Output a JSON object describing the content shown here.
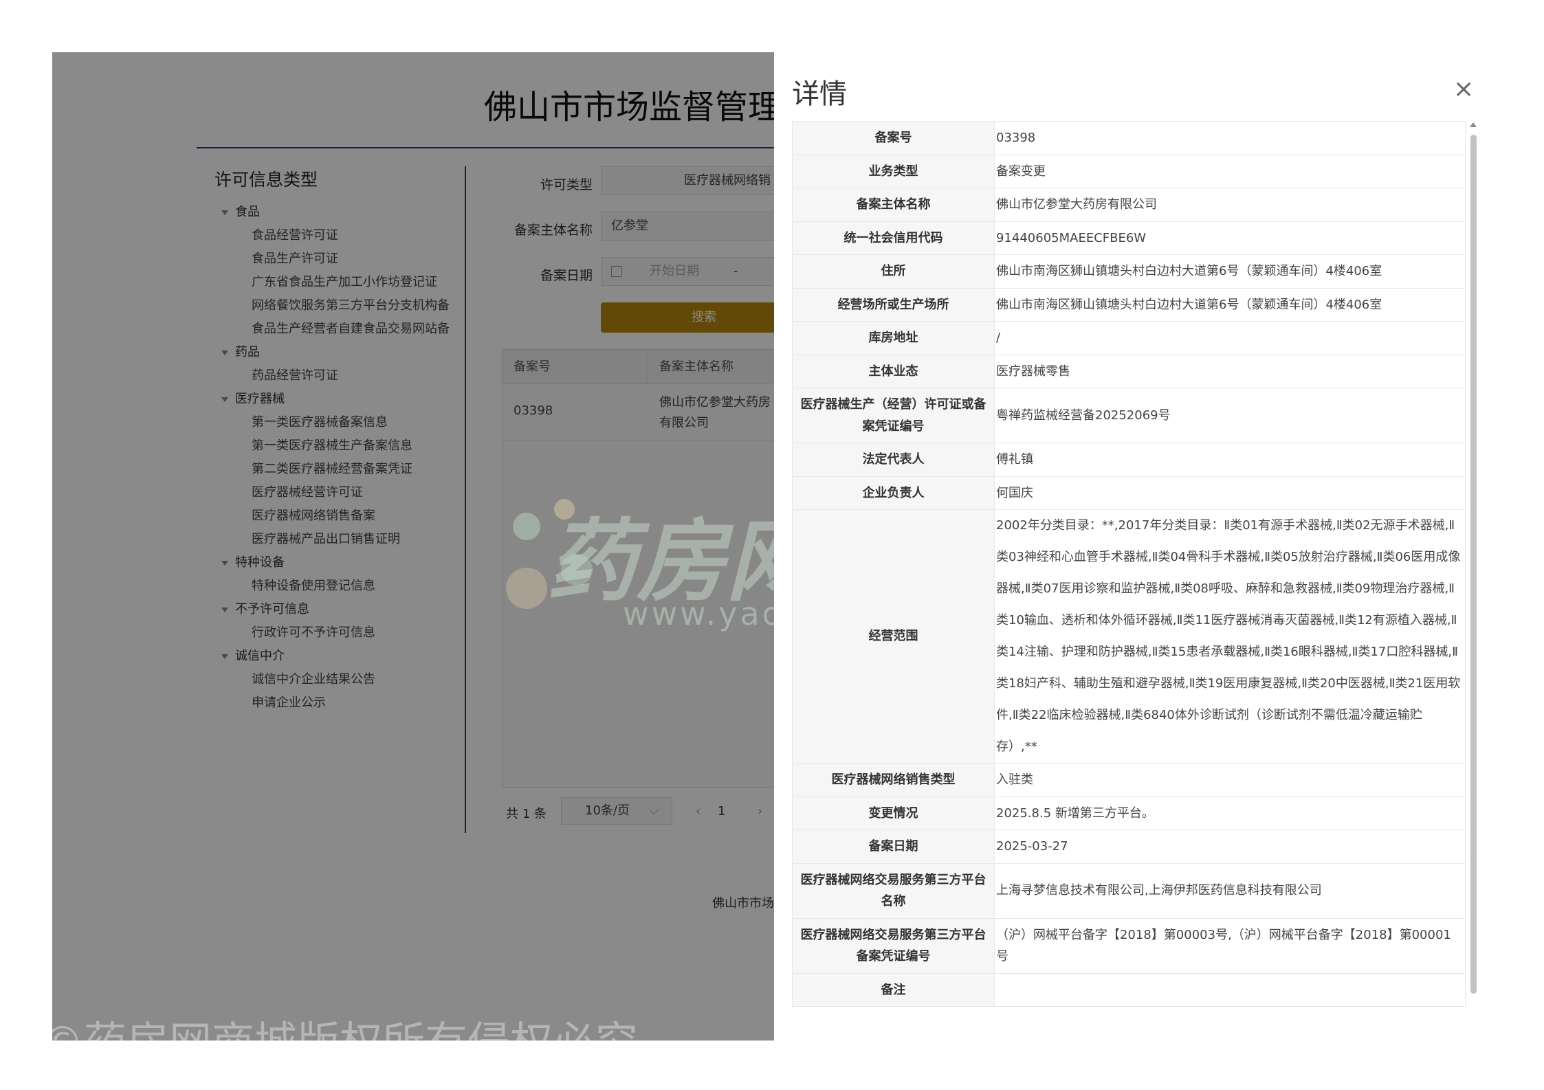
{
  "site": {
    "title": "佛山市市场监督管理",
    "footer": "佛山市市场"
  },
  "sidebar": {
    "title": "许可信息类型",
    "groups": [
      {
        "label": "食品",
        "items": [
          "食品经营许可证",
          "食品生产许可证",
          "广东省食品生产加工小作坊登记证",
          "网络餐饮服务第三方平台分支机构备",
          "食品生产经营者自建食品交易网站备"
        ]
      },
      {
        "label": "药品",
        "items": [
          "药品经营许可证"
        ]
      },
      {
        "label": "医疗器械",
        "items": [
          "第一类医疗器械备案信息",
          "第一类医疗器械生产备案信息",
          "第二类医疗器械经营备案凭证",
          "医疗器械经营许可证",
          "医疗器械网络销售备案",
          "医疗器械产品出口销售证明"
        ]
      },
      {
        "label": "特种设备",
        "items": [
          "特种设备使用登记信息"
        ]
      },
      {
        "label": "不予许可信息",
        "items": [
          "行政许可不予许可信息"
        ]
      },
      {
        "label": "诚信中介",
        "items": [
          "诚信中介企业结果公告",
          "申请企业公示"
        ]
      }
    ]
  },
  "search": {
    "type_label": "许可类型",
    "type_value": "医疗器械网络销",
    "name_label": "备案主体名称",
    "name_value": "亿参堂",
    "date_label": "备案日期",
    "date_placeholder": "开始日期",
    "date_sep": "-",
    "button": "搜索"
  },
  "results": {
    "columns": [
      "备案号",
      "备案主体名称"
    ],
    "rows": [
      {
        "no": "03398",
        "name_line1": "佛山市亿参堂大药房",
        "name_line2": "有限公司"
      }
    ]
  },
  "pager": {
    "total": "共 1 条",
    "size": "10条/页",
    "prev": "‹",
    "page": "1",
    "next": "›"
  },
  "watermark": {
    "text": "药房网商城",
    "sub": "www.yaofangwang.com",
    "copyright": "©药房网商城版权所有侵权必究"
  },
  "drawer": {
    "title": "详情",
    "close": "×",
    "rows": [
      {
        "k": "备案号",
        "v": "03398"
      },
      {
        "k": "业务类型",
        "v": "备案变更"
      },
      {
        "k": "备案主体名称",
        "v": "佛山市亿参堂大药房有限公司"
      },
      {
        "k": "统一社会信用代码",
        "v": "91440605MAEECFBE6W"
      },
      {
        "k": "住所",
        "v": "佛山市南海区狮山镇塘头村白边村大道第6号（蒙颖通车间）4楼406室"
      },
      {
        "k": "经营场所或生产场所",
        "v": "佛山市南海区狮山镇塘头村白边村大道第6号（蒙颖通车间）4楼406室"
      },
      {
        "k": "库房地址",
        "v": "/"
      },
      {
        "k": "主体业态",
        "v": "医疗器械零售"
      },
      {
        "k": "医疗器械生产（经营）许可证或备案凭证编号",
        "v": "粤禅药监械经营备20252069号"
      },
      {
        "k": "法定代表人",
        "v": "傅礼镇"
      },
      {
        "k": "企业负责人",
        "v": "何国庆"
      },
      {
        "k": "经营范围",
        "v": "2002年分类目录：**,2017年分类目录：Ⅱ类01有源手术器械,Ⅱ类02无源手术器械,Ⅱ类03神经和心血管手术器械,Ⅱ类04骨科手术器械,Ⅱ类05放射治疗器械,Ⅱ类06医用成像器械,Ⅱ类07医用诊察和监护器械,Ⅱ类08呼吸、麻醉和急救器械,Ⅱ类09物理治疗器械,Ⅱ类10输血、透析和体外循环器械,Ⅱ类11医疗器械消毒灭菌器械,Ⅱ类12有源植入器械,Ⅱ类14注输、护理和防护器械,Ⅱ类15患者承载器械,Ⅱ类16眼科器械,Ⅱ类17口腔科器械,Ⅱ类18妇产科、辅助生殖和避孕器械,Ⅱ类19医用康复器械,Ⅱ类20中医器械,Ⅱ类21医用软件,Ⅱ类22临床检验器械,Ⅱ类6840体外诊断试剂（诊断试剂不需低温冷藏运输贮存）,**"
      },
      {
        "k": "医疗器械网络销售类型",
        "v": "入驻类"
      },
      {
        "k": "变更情况",
        "v": "2025.8.5 新增第三方平台。"
      },
      {
        "k": "备案日期",
        "v": "2025-03-27"
      },
      {
        "k": "医疗器械网络交易服务第三方平台名称",
        "v": "上海寻梦信息技术有限公司,上海伊邦医药信息科技有限公司"
      },
      {
        "k": "医疗器械网络交易服务第三方平台备案凭证编号",
        "v": "（沪）网械平台备字【2018】第00003号,（沪）网械平台备字【2018】第00001号"
      },
      {
        "k": "备注",
        "v": ""
      }
    ]
  },
  "colors": {
    "accent": "#1b3f8f",
    "button": "#b8880f"
  }
}
